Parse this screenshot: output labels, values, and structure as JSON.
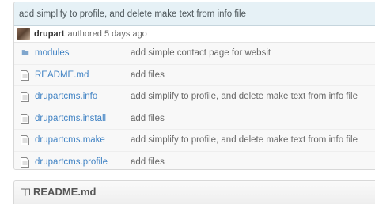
{
  "commit": {
    "message": "add simplify to profile, and delete make text from info file",
    "author": "drupart",
    "authored_text": "authored 5 days ago"
  },
  "files": [
    {
      "type": "folder",
      "icon": "folder-icon",
      "name": "modules",
      "message": "add simple contact page for websit"
    },
    {
      "type": "file",
      "icon": "file-icon",
      "name": "README.md",
      "message": "add files"
    },
    {
      "type": "file",
      "icon": "file-icon",
      "name": "drupartcms.info",
      "message": "add simplify to profile, and delete make text from info file"
    },
    {
      "type": "file",
      "icon": "file-icon",
      "name": "drupartcms.install",
      "message": "add files"
    },
    {
      "type": "file",
      "icon": "file-icon",
      "name": "drupartcms.make",
      "message": "add simplify to profile, and delete make text from info file"
    },
    {
      "type": "file",
      "icon": "file-icon",
      "name": "drupartcms.profile",
      "message": "add files"
    }
  ],
  "readme": {
    "title": "README.md",
    "icon": "book-icon"
  },
  "colors": {
    "link": "#4183c4",
    "commit_bg": "#e6f1f6",
    "folder": "#80a6cd"
  }
}
